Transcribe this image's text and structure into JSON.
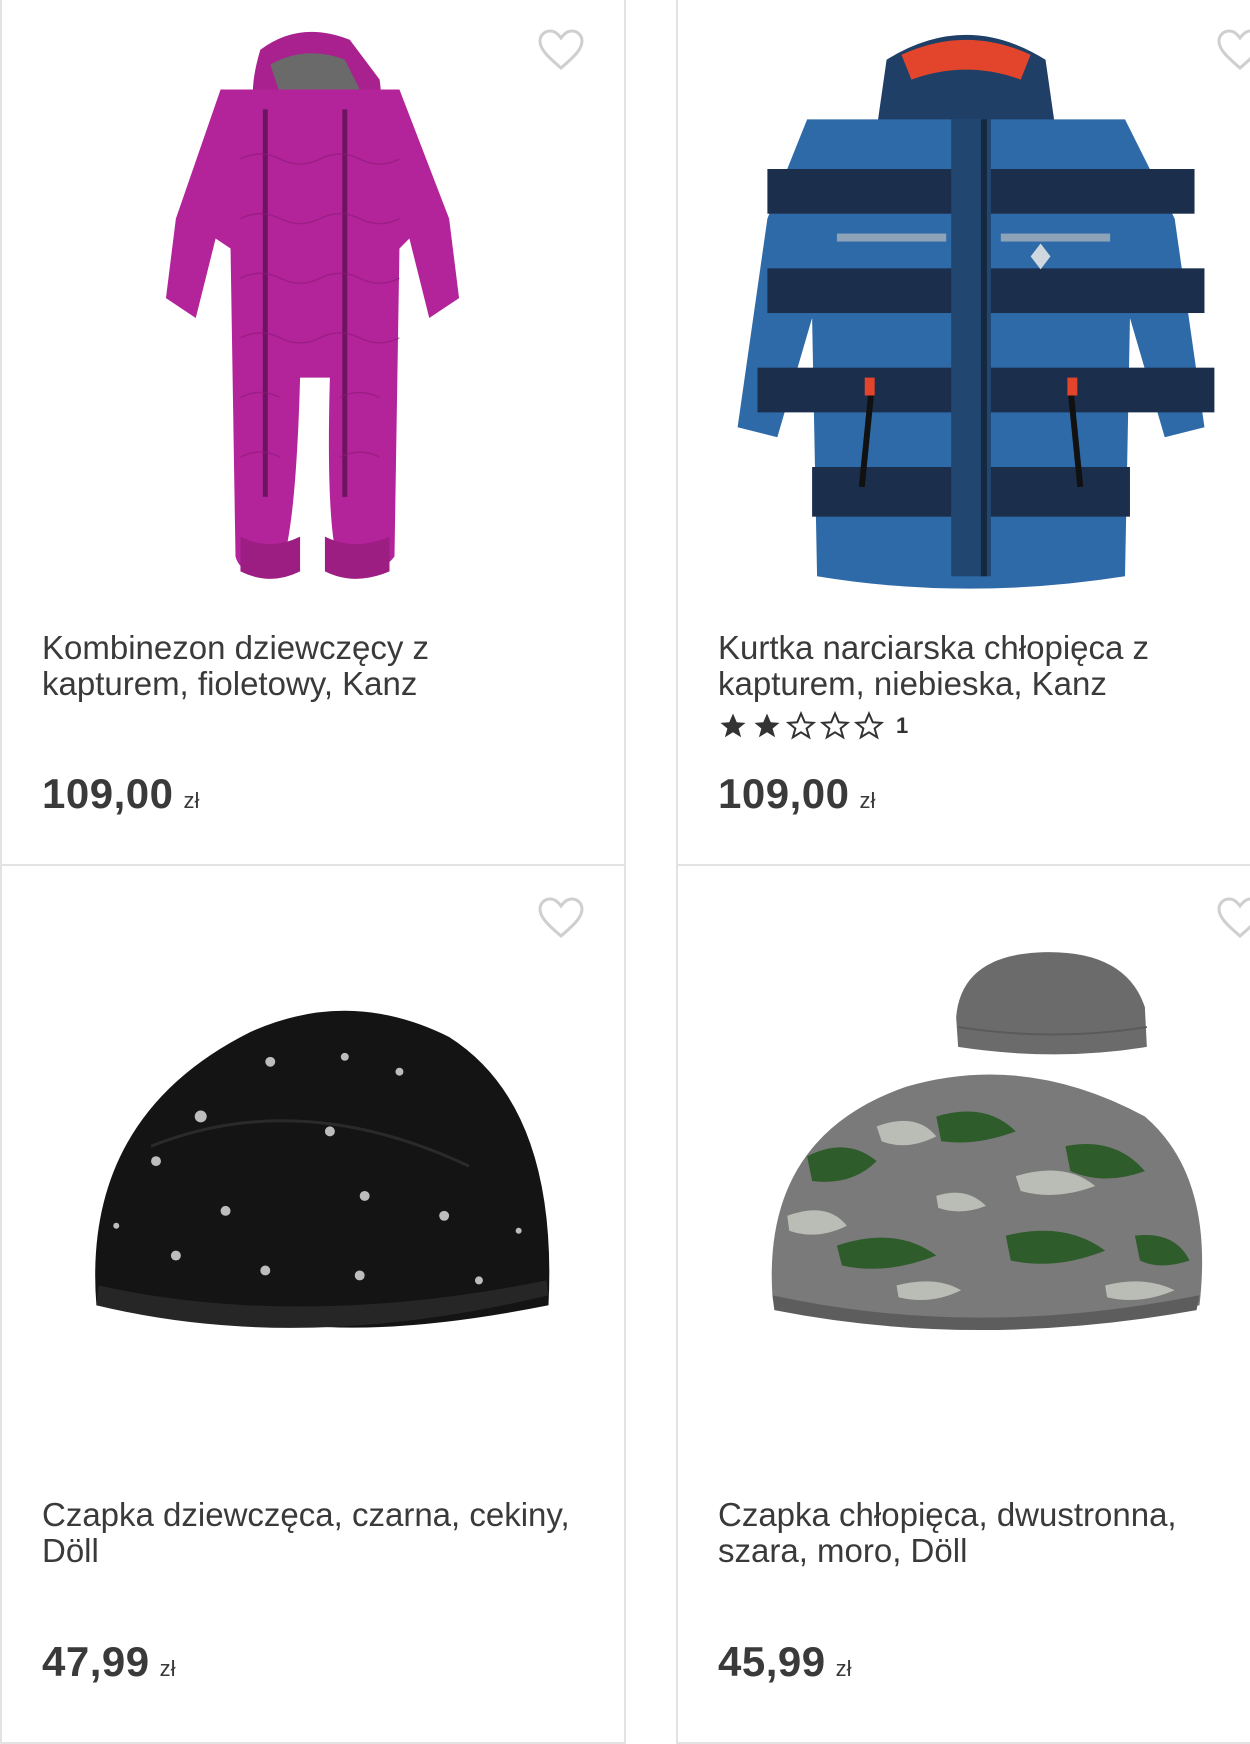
{
  "products": [
    {
      "title": "Kombinezon dziewczęcy z kapturem, fioletowy, Kanz",
      "price": "109,00",
      "currency": "zł",
      "image": "purple-snowsuit",
      "favorite": false
    },
    {
      "title": "Kurtka narciarska chłopięca z kapturem, niebieska, Kanz",
      "price": "109,00",
      "currency": "zł",
      "image": "blue-striped-jacket",
      "favorite": false,
      "rating": {
        "value": 2,
        "max": 5,
        "count": "1"
      }
    },
    {
      "title": "Czapka dziewczęca, czarna, cekiny, Döll",
      "price": "47,99",
      "currency": "zł",
      "image": "black-sequin-beanie",
      "favorite": false
    },
    {
      "title": "Czapka chłopięca, dwustronna, szara, moro, Döll",
      "price": "45,99",
      "currency": "zł",
      "image": "camo-reversible-beanie",
      "favorite": false
    }
  ],
  "colors": {
    "text": "#3a3a3a",
    "heart_outline": "#cfcfcf",
    "border": "#e3e3e3",
    "star": "#333333"
  }
}
